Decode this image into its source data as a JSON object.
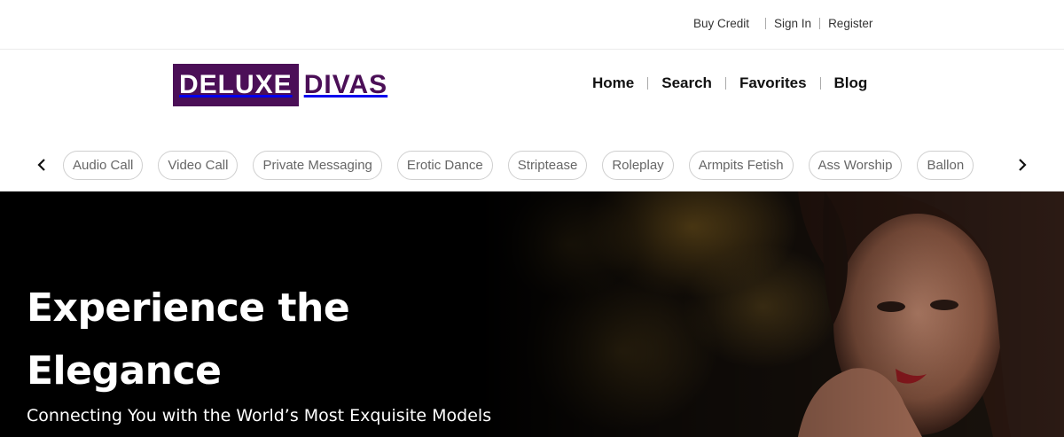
{
  "topbar": {
    "links": [
      "Buy Credit",
      "Sign In",
      "Register"
    ]
  },
  "logo": {
    "part1": "DELUXE",
    "part2": "DIVAS",
    "brand_color": "#4b0f57"
  },
  "nav": {
    "items": [
      "Home",
      "Search",
      "Favorites",
      "Blog"
    ]
  },
  "categories": {
    "prev_icon": "chevron-left-icon",
    "next_icon": "chevron-right-icon",
    "items": [
      "Audio Call",
      "Video Call",
      "Private Messaging",
      "Erotic Dance",
      "Striptease",
      "Roleplay",
      "Armpits Fetish",
      "Ass Worship",
      "Ballon"
    ]
  },
  "hero": {
    "title": "Experience the Elegance",
    "subtitle": "Connecting You with the World’s Most Exquisite Models"
  }
}
